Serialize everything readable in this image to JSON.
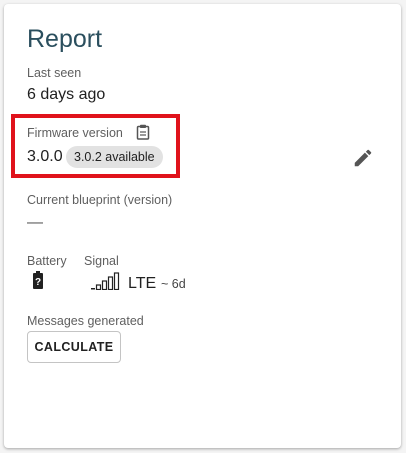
{
  "card": {
    "title": "Report",
    "last_seen": {
      "label": "Last seen",
      "value": "6 days ago"
    },
    "firmware": {
      "label": "Firmware version",
      "version": "3.0.0",
      "available_chip": "3.0.2 available",
      "copy_icon": "clipboard-icon",
      "edit_icon": "pencil-icon"
    },
    "blueprint": {
      "label": "Current blueprint (version)",
      "value": "—"
    },
    "battery": {
      "label": "Battery",
      "icon": "battery-unknown-icon"
    },
    "signal": {
      "label": "Signal",
      "type": "LTE",
      "age": "~ 6d",
      "icon": "signal-bars-icon"
    },
    "messages": {
      "label": "Messages generated",
      "button": "CALCULATE"
    }
  },
  "colors": {
    "title": "#2b4f5e",
    "highlight": "#e0121b",
    "chip_bg": "#e2e2e2"
  }
}
